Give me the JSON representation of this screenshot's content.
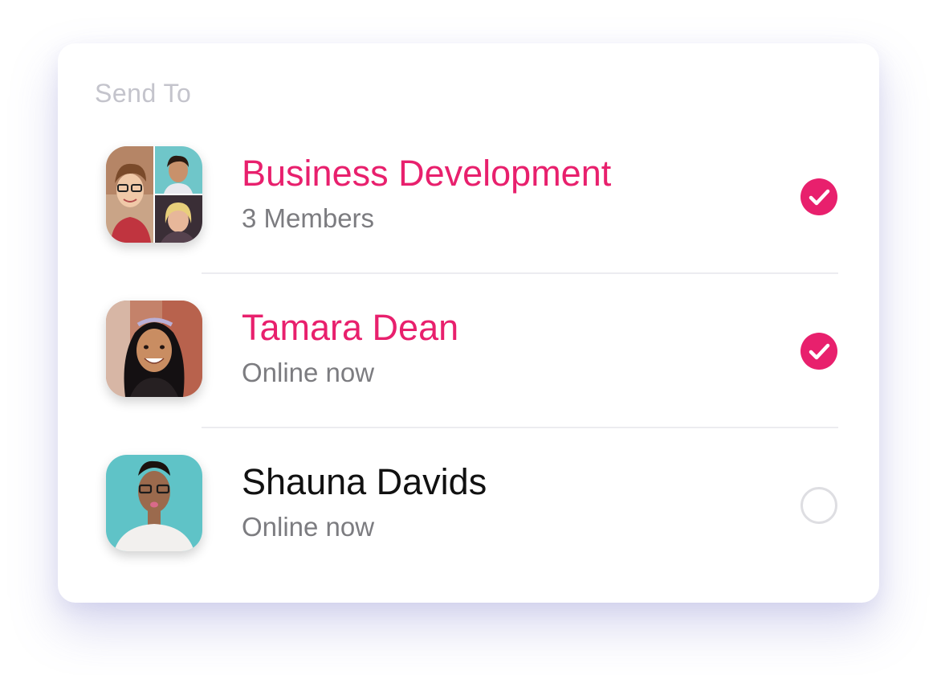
{
  "panel": {
    "title": "Send To",
    "accent_color": "#e8206d",
    "recipients": [
      {
        "name": "Business Development",
        "subtitle": "3 Members",
        "selected": true,
        "avatar": "group-avatar"
      },
      {
        "name": "Tamara Dean",
        "subtitle": "Online now",
        "selected": true,
        "avatar": "user-avatar"
      },
      {
        "name": "Shauna Davids",
        "subtitle": "Online now",
        "selected": false,
        "avatar": "user-avatar"
      }
    ]
  }
}
